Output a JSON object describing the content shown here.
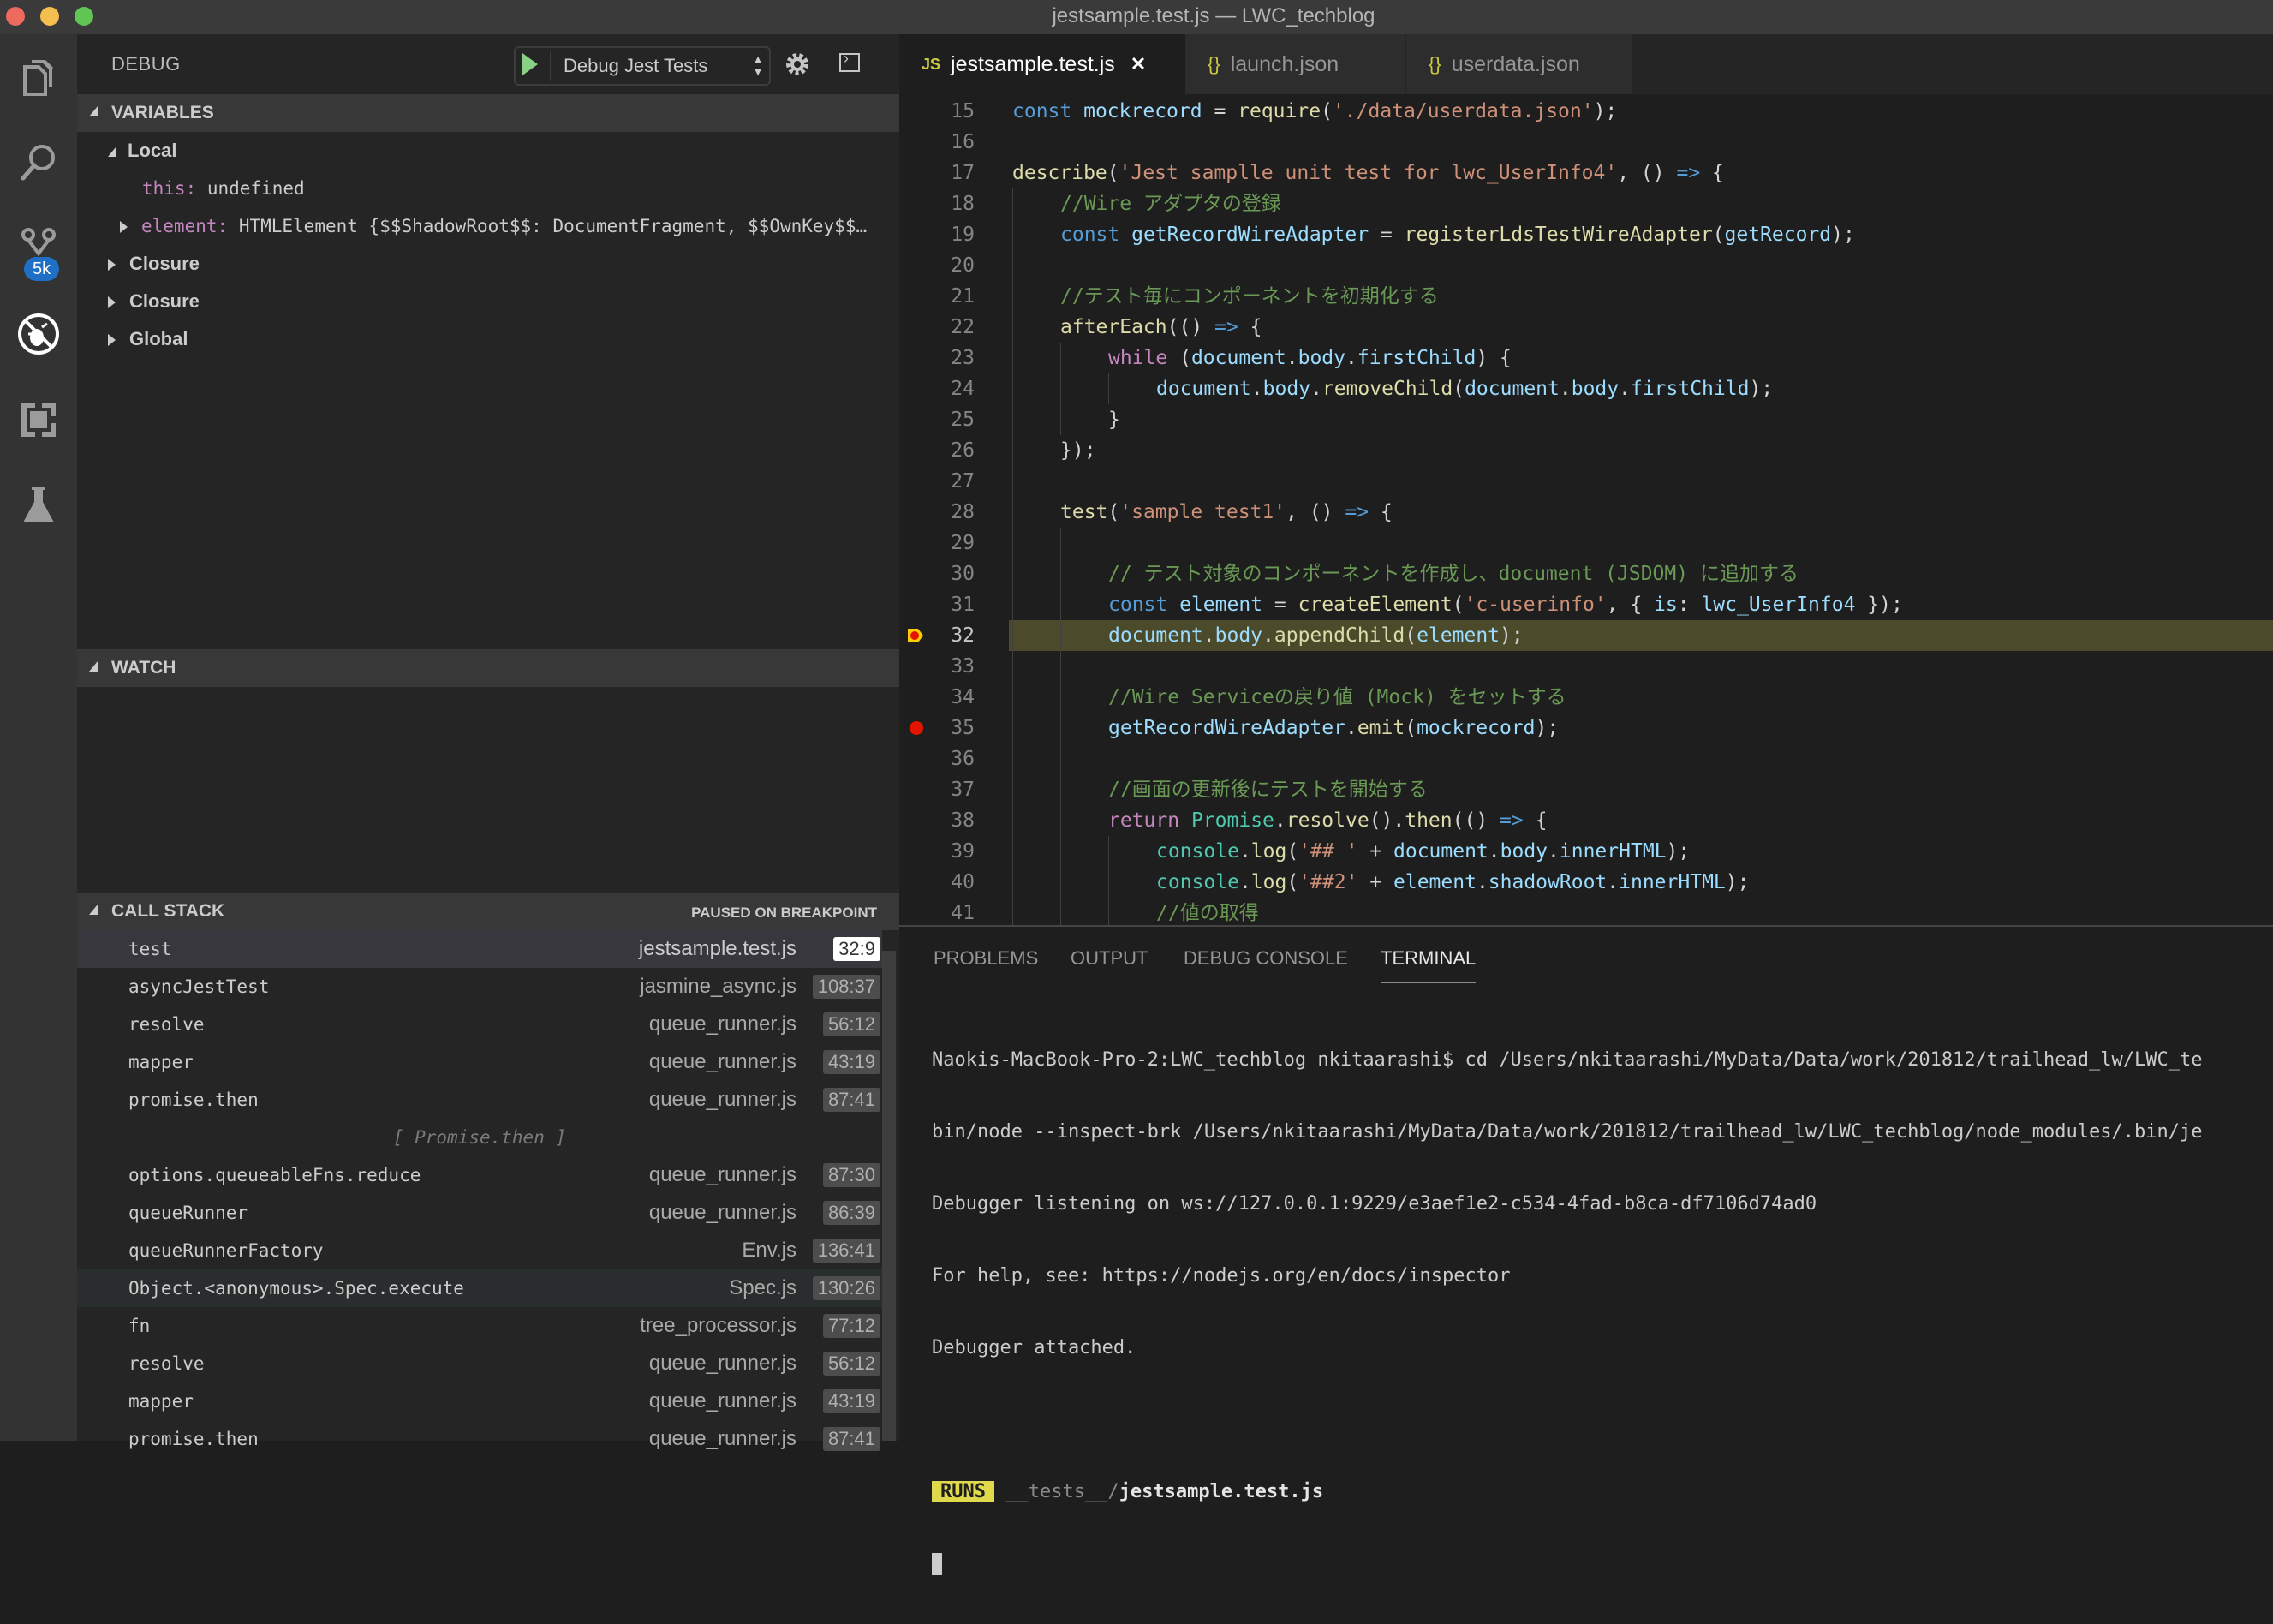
{
  "window": {
    "title": "jestsample.test.js — LWC_techblog"
  },
  "activity_bar": {
    "items": [
      {
        "name": "explorer",
        "icon": "files-icon"
      },
      {
        "name": "search",
        "icon": "search-icon"
      },
      {
        "name": "source-control",
        "icon": "source-control-icon",
        "badge": "5k"
      },
      {
        "name": "debug",
        "icon": "debug-icon",
        "active": true
      },
      {
        "name": "extensions",
        "icon": "extensions-icon"
      },
      {
        "name": "test",
        "icon": "flask-icon"
      }
    ]
  },
  "sidebar": {
    "title": "DEBUG",
    "launch_config": "Debug Jest Tests",
    "start_icon": "play-icon",
    "settings_icon": "gear-icon",
    "console_icon": "debug-console-icon",
    "variables": {
      "header": "VARIABLES",
      "scopes": [
        {
          "name": "Local",
          "expanded": true,
          "vars": [
            {
              "name": "this:",
              "value": "undefined",
              "expandable": false
            },
            {
              "name": "element:",
              "value": "HTMLElement {$$ShadowRoot$$: DocumentFragment, $$OwnKey$$…",
              "expandable": true
            }
          ]
        },
        {
          "name": "Closure",
          "expanded": false
        },
        {
          "name": "Closure",
          "expanded": false
        },
        {
          "name": "Global",
          "expanded": false
        }
      ]
    },
    "watch": {
      "header": "WATCH"
    },
    "call_stack": {
      "header": "CALL STACK",
      "status": "PAUSED ON BREAKPOINT",
      "frames": [
        {
          "fn": "test",
          "file": "jestsample.test.js",
          "pos": "32:9",
          "selected": true
        },
        {
          "fn": "asyncJestTest",
          "file": "jasmine_async.js",
          "pos": "108:37"
        },
        {
          "fn": "resolve",
          "file": "queue_runner.js",
          "pos": "56:12"
        },
        {
          "fn": "mapper",
          "file": "queue_runner.js",
          "pos": "43:19"
        },
        {
          "fn": "promise.then",
          "file": "queue_runner.js",
          "pos": "87:41"
        },
        {
          "label": "[ Promise.then ]"
        },
        {
          "fn": "options.queueableFns.reduce",
          "file": "queue_runner.js",
          "pos": "87:30"
        },
        {
          "fn": "queueRunner",
          "file": "queue_runner.js",
          "pos": "86:39"
        },
        {
          "fn": "queueRunnerFactory",
          "file": "Env.js",
          "pos": "136:41"
        },
        {
          "fn": "Object.<anonymous>.Spec.execute",
          "file": "Spec.js",
          "pos": "130:26",
          "hover": true
        },
        {
          "fn": "fn",
          "file": "tree_processor.js",
          "pos": "77:12"
        },
        {
          "fn": "resolve",
          "file": "queue_runner.js",
          "pos": "56:12"
        },
        {
          "fn": "mapper",
          "file": "queue_runner.js",
          "pos": "43:19"
        },
        {
          "fn": "promise.then",
          "file": "queue_runner.js",
          "pos": "87:41"
        }
      ]
    }
  },
  "editor": {
    "tabs": [
      {
        "label": "jestsample.test.js",
        "icon": "JS",
        "active": true,
        "closable": true
      },
      {
        "label": "launch.json",
        "icon": "{}"
      },
      {
        "label": "userdata.json",
        "icon": "{}"
      }
    ],
    "current_line": 32,
    "breakpoints": [
      35
    ],
    "lines": [
      {
        "n": "15",
        "indent": 0,
        "tokens": [
          [
            "k",
            "const "
          ],
          [
            "v",
            "mockrecord"
          ],
          [
            "",
            "="
          ],
          [
            "",
            ""
          ]
        ],
        "text": "const mockrecord = require('./data/userdata.json');"
      },
      {
        "n": "16",
        "indent": 0,
        "text": ""
      },
      {
        "n": "17",
        "indent": 0,
        "text": "describe('Jest samplle unit test for lwc_UserInfo4', () => {"
      },
      {
        "n": "18",
        "indent": 1,
        "text": "//Wire アダプタの登録"
      },
      {
        "n": "19",
        "indent": 1,
        "text": "const getRecordWireAdapter = registerLdsTestWireAdapter(getRecord);"
      },
      {
        "n": "20",
        "indent": 0,
        "text": ""
      },
      {
        "n": "21",
        "indent": 1,
        "text": "//テスト毎にコンポーネントを初期化する"
      },
      {
        "n": "22",
        "indent": 1,
        "text": "afterEach(() => {"
      },
      {
        "n": "23",
        "indent": 2,
        "text": "while (document.body.firstChild) {"
      },
      {
        "n": "24",
        "indent": 3,
        "text": "document.body.removeChild(document.body.firstChild);"
      },
      {
        "n": "25",
        "indent": 2,
        "text": "}"
      },
      {
        "n": "26",
        "indent": 1,
        "text": "});"
      },
      {
        "n": "27",
        "indent": 0,
        "text": ""
      },
      {
        "n": "28",
        "indent": 1,
        "text": "test('sample test1', () => {"
      },
      {
        "n": "29",
        "indent": 0,
        "text": ""
      },
      {
        "n": "30",
        "indent": 2,
        "text": "// テスト対象のコンポーネントを作成し、document (JSDOM) に追加する"
      },
      {
        "n": "31",
        "indent": 2,
        "text": "const element = createElement('c-userinfo', { is: lwc_UserInfo4 });"
      },
      {
        "n": "32",
        "indent": 2,
        "text": "document.body.appendChild(element);"
      },
      {
        "n": "33",
        "indent": 0,
        "text": ""
      },
      {
        "n": "34",
        "indent": 2,
        "text": "//Wire Serviceの戻り値 (Mock) をセットする"
      },
      {
        "n": "35",
        "indent": 2,
        "text": "getRecordWireAdapter.emit(mockrecord);"
      },
      {
        "n": "36",
        "indent": 0,
        "text": ""
      },
      {
        "n": "37",
        "indent": 2,
        "text": "//画面の更新後にテストを開始する"
      },
      {
        "n": "38",
        "indent": 2,
        "text": "return Promise.resolve().then(() => {"
      },
      {
        "n": "39",
        "indent": 3,
        "text": "console.log('## ' + document.body.innerHTML);"
      },
      {
        "n": "40",
        "indent": 3,
        "text": "console.log('##2' + element.shadowRoot.innerHTML);"
      },
      {
        "n": "41",
        "indent": 3,
        "text": "//値の取得"
      }
    ]
  },
  "panel": {
    "tabs": [
      "PROBLEMS",
      "OUTPUT",
      "DEBUG CONSOLE",
      "TERMINAL"
    ],
    "active_tab": "TERMINAL",
    "terminal_lines": [
      "Naokis-MacBook-Pro-2:LWC_techblog nkitaarashi$ cd /Users/nkitaarashi/MyData/Data/work/201812/trailhead_lw/LWC_te",
      "bin/node --inspect-brk /Users/nkitaarashi/MyData/Data/work/201812/trailhead_lw/LWC_techblog/node_modules/.bin/je",
      "Debugger listening on ws://127.0.0.1:9229/e3aef1e2-c534-4fad-b8ca-df7106d74ad0",
      "For help, see: https://nodejs.org/en/docs/inspector",
      "Debugger attached."
    ],
    "runs_badge": "RUNS",
    "runs_dir": "__tests__/",
    "runs_file": "jestsample.test.js"
  },
  "colors": {
    "accent_badge": "#1f6fc7",
    "breakpoint": "#e51400",
    "current_line_bg": "#4b4b2c",
    "runs_badge": "#e0d94b"
  }
}
